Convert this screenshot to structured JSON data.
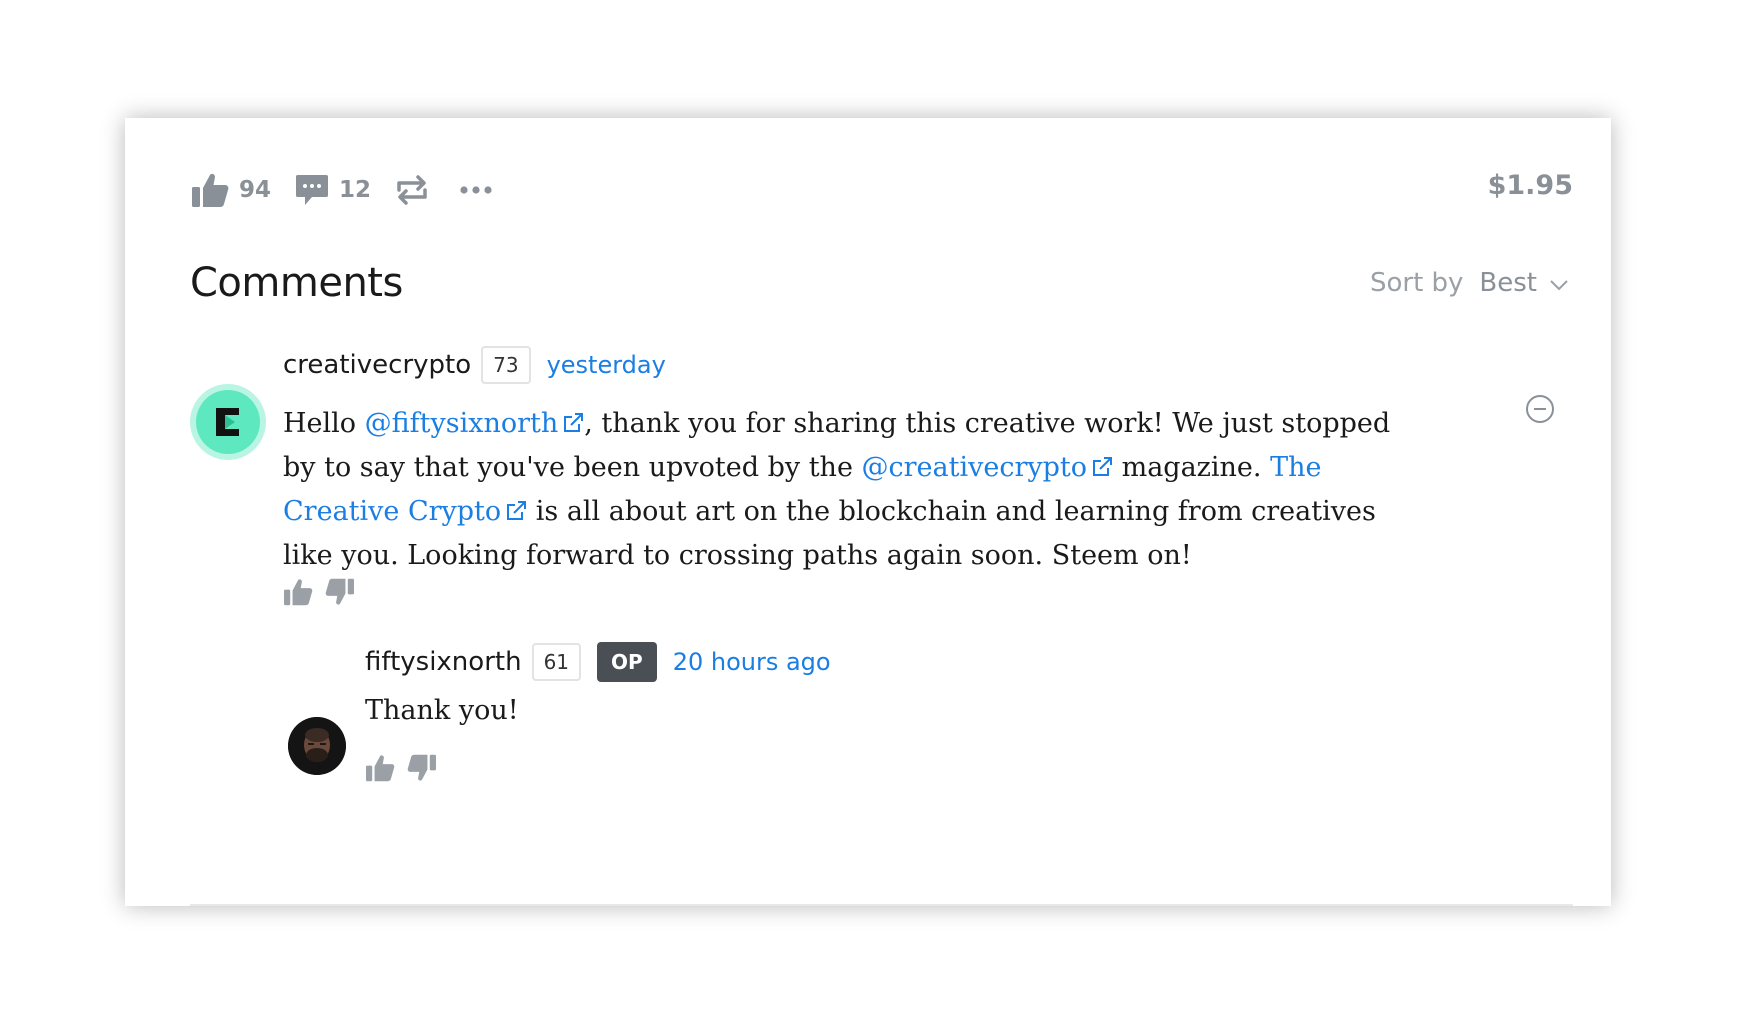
{
  "actions": {
    "upvote_count": "94",
    "comment_count": "12",
    "payout": "$1.95"
  },
  "header": {
    "title": "Comments",
    "sort_label": "Sort by",
    "sort_value": "Best"
  },
  "comments": [
    {
      "author": "creativecrypto",
      "reputation": "73",
      "time": "yesterday",
      "body": {
        "p1": "Hello ",
        "link1": "@fiftysixnorth",
        "p2": ", thank you for sharing this creative work! We just stopped by to say that you've been upvoted by the ",
        "link2": "@creativecrypto",
        "p3": " magazine. ",
        "link3": "The Creative Crypto",
        "p4": " is all about art on the blockchain and learning from creatives like you. Looking forward to crossing paths again soon. Steem on!"
      }
    },
    {
      "author": "fiftysixnorth",
      "reputation": "61",
      "badge": "OP",
      "time": "20 hours ago",
      "body": "Thank you!"
    }
  ],
  "colors": {
    "link": "#1a7ee3",
    "muted": "#8a9097",
    "op_badge": "#4a4f55",
    "avatar_accent": "#5ee8bf"
  },
  "icons": [
    "thumbs-up-icon",
    "comment-icon",
    "resteem-icon",
    "more-icon",
    "chevron-down-icon",
    "collapse-icon",
    "external-link-icon",
    "thumbs-down-icon"
  ]
}
